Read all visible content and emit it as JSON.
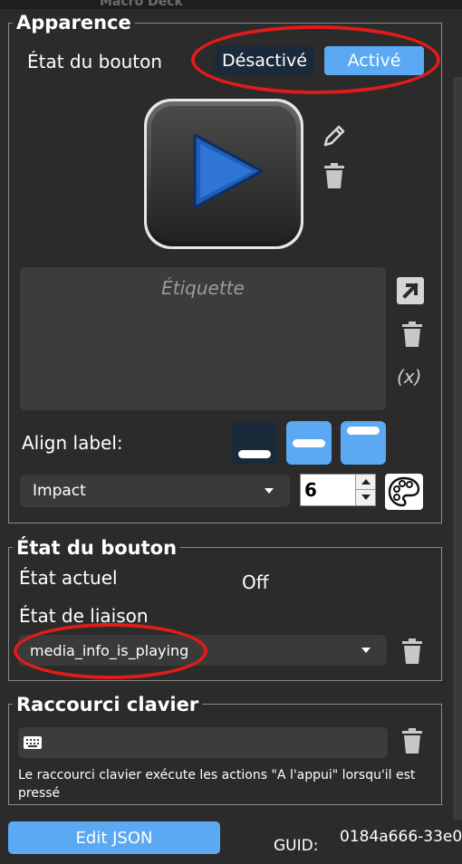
{
  "window": {
    "title_fragment": "Macro Deck"
  },
  "appearance": {
    "title": "Apparence",
    "state_label": "État du bouton",
    "toggle": {
      "off_label": "Désactivé",
      "on_label": "Activé",
      "selected": "Activé"
    },
    "label_placeholder": "Étiquette",
    "variable_label": "(x)",
    "align_label": "Align label:",
    "font": {
      "name": "Impact",
      "size": "6"
    }
  },
  "button_state": {
    "title": "État du bouton",
    "current_label": "État actuel",
    "current_value": "Off",
    "binding_label": "État de liaison",
    "binding_value": "media_info_is_playing"
  },
  "hotkey": {
    "title": "Raccourci clavier",
    "help_text": "Le raccourci clavier exécute les actions \"A l'appui\" lorsqu'il est pressé"
  },
  "footer": {
    "edit_json_label": "Edit JSON",
    "guid_label": "GUID:",
    "guid_value": "0184a666-33e0"
  },
  "colors": {
    "background": "#2b2b2b",
    "accent": "#5aa9f2",
    "annotation": "#e01b1b"
  }
}
